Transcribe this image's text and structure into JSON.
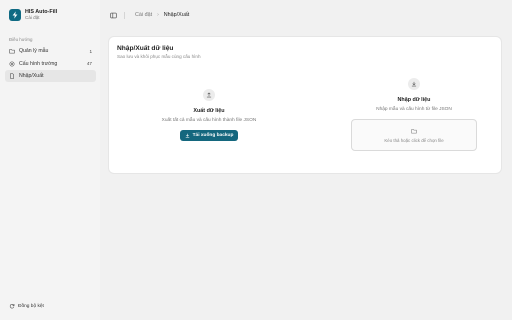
{
  "app": {
    "name": "HIS Auto-Fill",
    "subtitle": "Cài đặt"
  },
  "sidebar": {
    "section_label": "Điều hướng",
    "items": [
      {
        "label": "Quản lý mẫu",
        "count": "1",
        "icon": "folder-icon",
        "active": false
      },
      {
        "label": "Cấu hình trường",
        "count": "47",
        "icon": "settings-icon",
        "active": false
      },
      {
        "label": "Nhập/Xuất",
        "count": "",
        "icon": "document-icon",
        "active": true
      }
    ],
    "footer": {
      "label": "Đồng bộ kệt",
      "icon": "sync-icon"
    }
  },
  "topbar": {
    "breadcrumb": [
      "Cài đặt",
      "Nhập/Xuất"
    ],
    "separator": "›"
  },
  "panel": {
    "title": "Nhập/Xuất dữ liệu",
    "description": "Sao lưu và khôi phục mẫu cùng cấu hình"
  },
  "export": {
    "title": "Xuất dữ liệu",
    "description": "Xuất tất cả mẫu và cấu hình thành file JSON",
    "button_label": "Tải xuống backup"
  },
  "import": {
    "title": "Nhập dữ liệu",
    "description": "Nhập mẫu và cấu hình từ file JSON",
    "dropzone_label": "Kéo thả hoặc click để chọn file"
  },
  "colors": {
    "accent": "#14677e",
    "brand": "#0f6a83"
  }
}
